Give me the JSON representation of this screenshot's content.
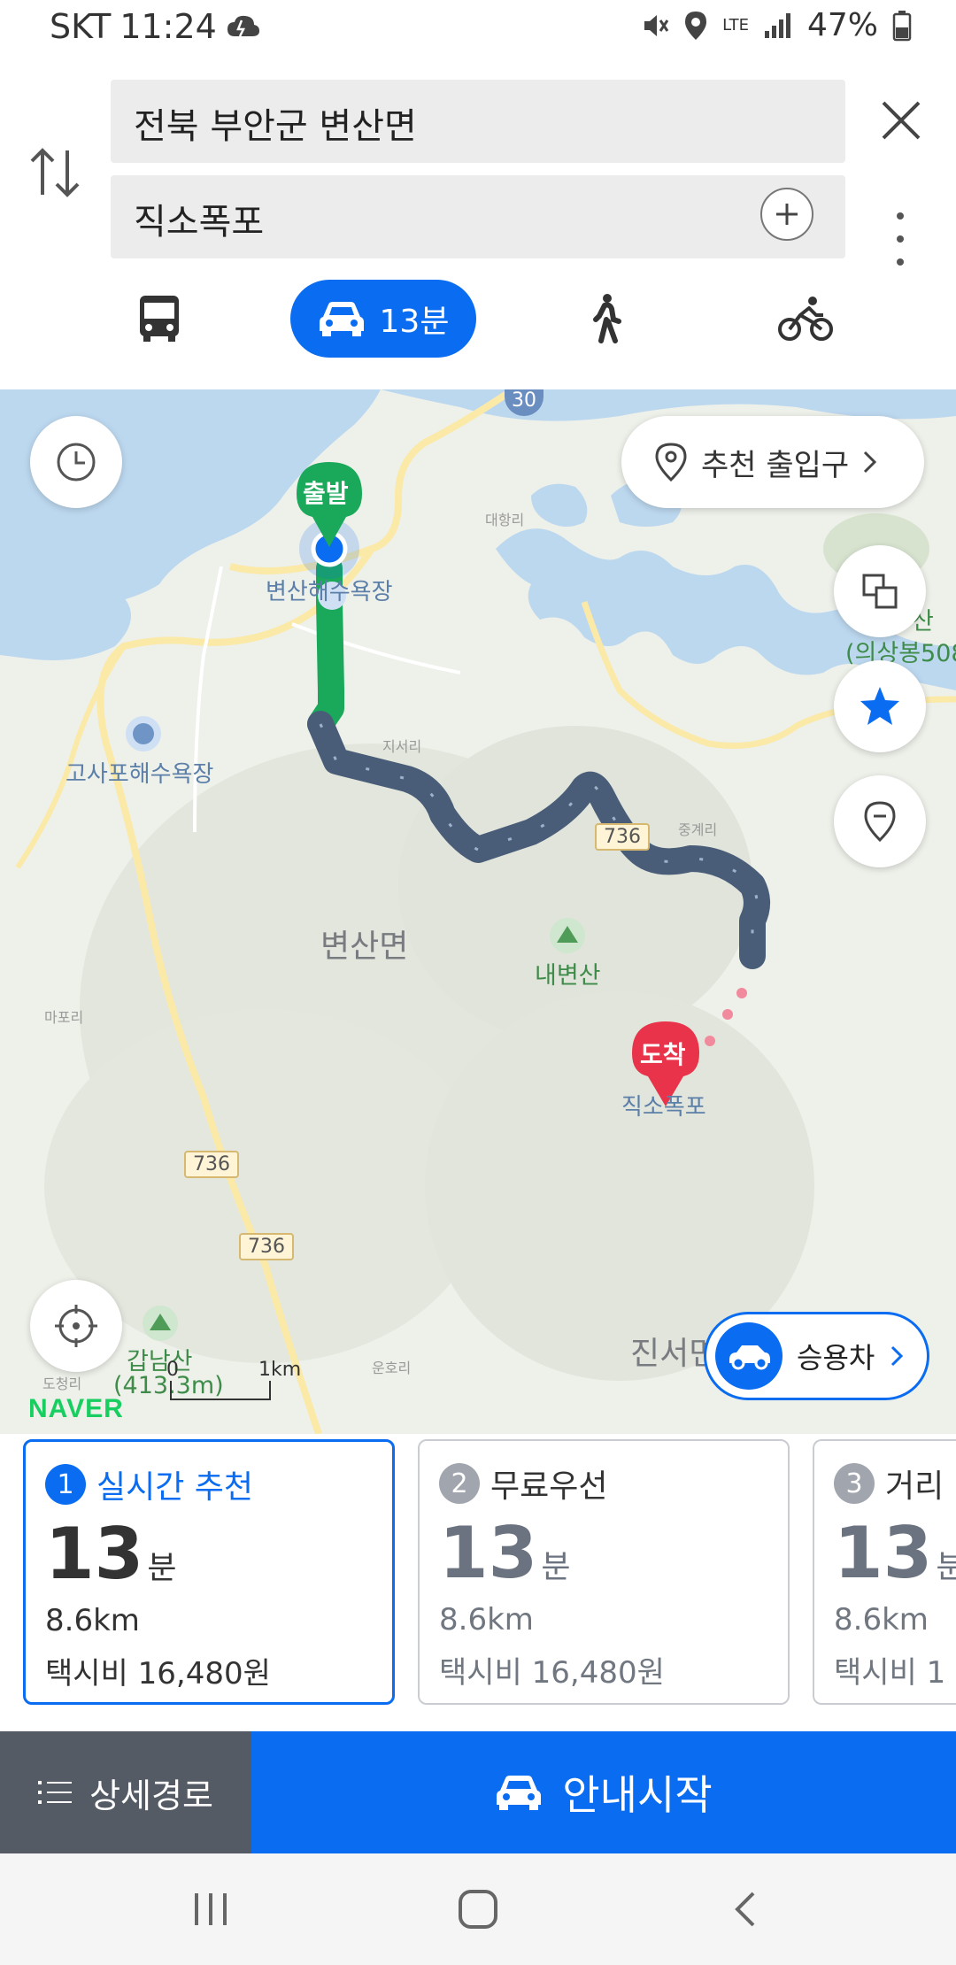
{
  "status_bar": {
    "carrier": "SKT",
    "time": "11:24",
    "network": "LTE",
    "battery": "47%"
  },
  "search": {
    "origin": "전북 부안군 변산면",
    "destination": "직소폭포"
  },
  "modes": [
    {
      "id": "bus",
      "icon": "bus-icon"
    },
    {
      "id": "car",
      "icon": "car-icon",
      "label": "13분",
      "selected": true
    },
    {
      "id": "walk",
      "icon": "walk-icon"
    },
    {
      "id": "bike",
      "icon": "bike-icon"
    }
  ],
  "map": {
    "entrance_button": "추천 출입구",
    "start_marker": "출발",
    "end_marker": "도착",
    "vehicle_button": "승용차",
    "labels": {
      "start_place": "변산해수욕장",
      "end_place": "직소폭포",
      "beach2": "고사포해수욕장",
      "area": "변산면",
      "mountain": "내변산",
      "mountain2": "갑남산",
      "mountain2_height": "(413.3m)",
      "mountain3": "산",
      "mountain3_sub": "(의상봉508",
      "area2": "진서면",
      "village1": "대항리",
      "village2": "지서리",
      "village3": "중계리",
      "village4": "마포리",
      "village5": "운호리",
      "village6": "도청리",
      "road_30": "30",
      "road_736a": "736",
      "road_736b": "736",
      "road_736c": "736"
    },
    "scale_zero": "0",
    "scale_label": "1km",
    "logo": "NAVER"
  },
  "routes": [
    {
      "num": "1",
      "name": "실시간 추천",
      "time": "13",
      "unit": "분",
      "distance": "8.6km",
      "fare": "택시비 16,480원",
      "active": true
    },
    {
      "num": "2",
      "name": "무료우선",
      "time": "13",
      "unit": "분",
      "distance": "8.6km",
      "fare": "택시비 16,480원"
    },
    {
      "num": "3",
      "name": "거리",
      "time": "13",
      "unit": "분",
      "distance": "8.6km",
      "fare": "택시비 1"
    }
  ],
  "actions": {
    "detail": "상세경로",
    "start": "안내시작"
  },
  "colors": {
    "accent": "#0a6cf0",
    "route": "#4a5d78",
    "start": "#1aa85a",
    "end": "#e8334a",
    "water": "#bcd8ef"
  }
}
